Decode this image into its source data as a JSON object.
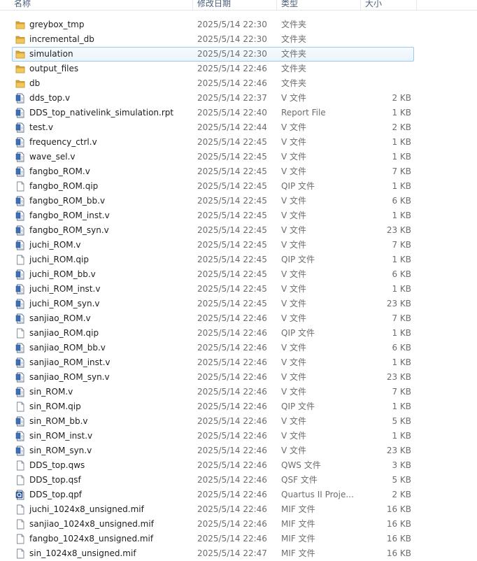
{
  "columns": {
    "name": "名称",
    "date": "修改日期",
    "type": "类型",
    "size": "大小"
  },
  "icons": {
    "folder": "folder-icon",
    "verilog": "verilog-file-icon",
    "document": "document-icon",
    "quartus": "quartus-project-icon"
  },
  "colors": {
    "folder_fill": "#e8b84a",
    "selection_border": "#99c9ef",
    "selection_fill": "#eaf4fc"
  },
  "files": [
    {
      "name": "greybox_tmp",
      "date": "2025/5/14 22:30",
      "type": "文件夹",
      "size": "",
      "icon": "folder"
    },
    {
      "name": "incremental_db",
      "date": "2025/5/14 22:30",
      "type": "文件夹",
      "size": "",
      "icon": "folder"
    },
    {
      "name": "simulation",
      "date": "2025/5/14 22:30",
      "type": "文件夹",
      "size": "",
      "icon": "folder",
      "selected": true
    },
    {
      "name": "output_files",
      "date": "2025/5/14 22:46",
      "type": "文件夹",
      "size": "",
      "icon": "folder"
    },
    {
      "name": "db",
      "date": "2025/5/14 22:46",
      "type": "文件夹",
      "size": "",
      "icon": "folder"
    },
    {
      "name": "dds_top.v",
      "date": "2025/5/14 22:37",
      "type": "V 文件",
      "size": "2 KB",
      "icon": "verilog"
    },
    {
      "name": "DDS_top_nativelink_simulation.rpt",
      "date": "2025/5/14 22:40",
      "type": "Report File",
      "size": "1 KB",
      "icon": "verilog"
    },
    {
      "name": "test.v",
      "date": "2025/5/14 22:44",
      "type": "V 文件",
      "size": "2 KB",
      "icon": "verilog"
    },
    {
      "name": "frequency_ctrl.v",
      "date": "2025/5/14 22:45",
      "type": "V 文件",
      "size": "1 KB",
      "icon": "verilog"
    },
    {
      "name": "wave_sel.v",
      "date": "2025/5/14 22:45",
      "type": "V 文件",
      "size": "1 KB",
      "icon": "verilog"
    },
    {
      "name": "fangbo_ROM.v",
      "date": "2025/5/14 22:45",
      "type": "V 文件",
      "size": "7 KB",
      "icon": "verilog"
    },
    {
      "name": "fangbo_ROM.qip",
      "date": "2025/5/14 22:45",
      "type": "QIP 文件",
      "size": "1 KB",
      "icon": "document"
    },
    {
      "name": "fangbo_ROM_bb.v",
      "date": "2025/5/14 22:45",
      "type": "V 文件",
      "size": "6 KB",
      "icon": "verilog"
    },
    {
      "name": "fangbo_ROM_inst.v",
      "date": "2025/5/14 22:45",
      "type": "V 文件",
      "size": "1 KB",
      "icon": "verilog"
    },
    {
      "name": "fangbo_ROM_syn.v",
      "date": "2025/5/14 22:45",
      "type": "V 文件",
      "size": "23 KB",
      "icon": "verilog"
    },
    {
      "name": "juchi_ROM.v",
      "date": "2025/5/14 22:45",
      "type": "V 文件",
      "size": "7 KB",
      "icon": "verilog"
    },
    {
      "name": "juchi_ROM.qip",
      "date": "2025/5/14 22:45",
      "type": "QIP 文件",
      "size": "1 KB",
      "icon": "document"
    },
    {
      "name": "juchi_ROM_bb.v",
      "date": "2025/5/14 22:45",
      "type": "V 文件",
      "size": "6 KB",
      "icon": "verilog"
    },
    {
      "name": "juchi_ROM_inst.v",
      "date": "2025/5/14 22:45",
      "type": "V 文件",
      "size": "1 KB",
      "icon": "verilog"
    },
    {
      "name": "juchi_ROM_syn.v",
      "date": "2025/5/14 22:45",
      "type": "V 文件",
      "size": "23 KB",
      "icon": "verilog"
    },
    {
      "name": "sanjiao_ROM.v",
      "date": "2025/5/14 22:46",
      "type": "V 文件",
      "size": "7 KB",
      "icon": "verilog"
    },
    {
      "name": "sanjiao_ROM.qip",
      "date": "2025/5/14 22:46",
      "type": "QIP 文件",
      "size": "1 KB",
      "icon": "document"
    },
    {
      "name": "sanjiao_ROM_bb.v",
      "date": "2025/5/14 22:46",
      "type": "V 文件",
      "size": "6 KB",
      "icon": "verilog"
    },
    {
      "name": "sanjiao_ROM_inst.v",
      "date": "2025/5/14 22:46",
      "type": "V 文件",
      "size": "1 KB",
      "icon": "verilog"
    },
    {
      "name": "sanjiao_ROM_syn.v",
      "date": "2025/5/14 22:46",
      "type": "V 文件",
      "size": "23 KB",
      "icon": "verilog"
    },
    {
      "name": "sin_ROM.v",
      "date": "2025/5/14 22:46",
      "type": "V 文件",
      "size": "7 KB",
      "icon": "verilog"
    },
    {
      "name": "sin_ROM.qip",
      "date": "2025/5/14 22:46",
      "type": "QIP 文件",
      "size": "1 KB",
      "icon": "document"
    },
    {
      "name": "sin_ROM_bb.v",
      "date": "2025/5/14 22:46",
      "type": "V 文件",
      "size": "5 KB",
      "icon": "verilog"
    },
    {
      "name": "sin_ROM_inst.v",
      "date": "2025/5/14 22:46",
      "type": "V 文件",
      "size": "1 KB",
      "icon": "verilog"
    },
    {
      "name": "sin_ROM_syn.v",
      "date": "2025/5/14 22:46",
      "type": "V 文件",
      "size": "23 KB",
      "icon": "verilog"
    },
    {
      "name": "DDS_top.qws",
      "date": "2025/5/14 22:46",
      "type": "QWS 文件",
      "size": "3 KB",
      "icon": "document"
    },
    {
      "name": "DDS_top.qsf",
      "date": "2025/5/14 22:46",
      "type": "QSF 文件",
      "size": "5 KB",
      "icon": "document"
    },
    {
      "name": "DDS_top.qpf",
      "date": "2025/5/14 22:46",
      "type": "Quartus II Proje...",
      "size": "2 KB",
      "icon": "quartus"
    },
    {
      "name": "juchi_1024x8_unsigned.mif",
      "date": "2025/5/14 22:46",
      "type": "MIF 文件",
      "size": "16 KB",
      "icon": "document"
    },
    {
      "name": "sanjiao_1024x8_unsigned.mif",
      "date": "2025/5/14 22:46",
      "type": "MIF 文件",
      "size": "16 KB",
      "icon": "document"
    },
    {
      "name": "fangbo_1024x8_unsigned.mif",
      "date": "2025/5/14 22:46",
      "type": "MIF 文件",
      "size": "16 KB",
      "icon": "document"
    },
    {
      "name": "sin_1024x8_unsigned.mif",
      "date": "2025/5/14 22:47",
      "type": "MIF 文件",
      "size": "16 KB",
      "icon": "document"
    }
  ]
}
